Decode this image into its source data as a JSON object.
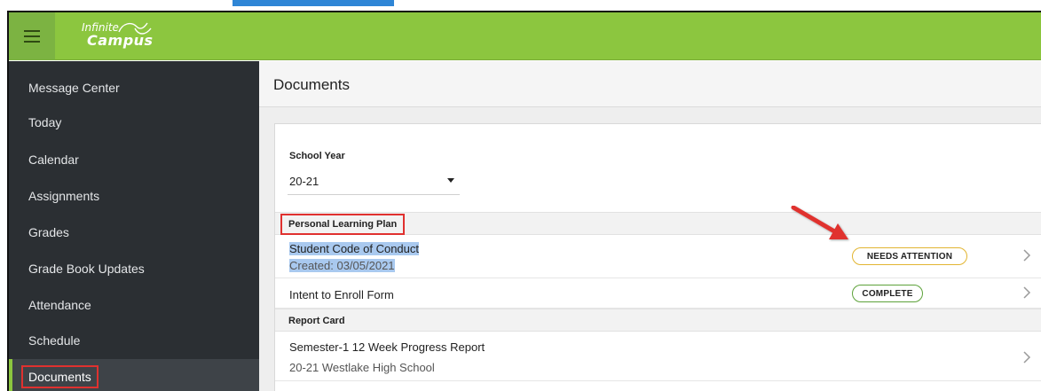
{
  "app": {
    "brand_line1": "Infinite",
    "brand_line2": "Campus"
  },
  "sidebar": {
    "items": [
      {
        "label": "Message Center"
      },
      {
        "label": "Today"
      },
      {
        "label": "Calendar"
      },
      {
        "label": "Assignments"
      },
      {
        "label": "Grades"
      },
      {
        "label": "Grade Book Updates"
      },
      {
        "label": "Attendance"
      },
      {
        "label": "Schedule"
      },
      {
        "label": "Documents",
        "active": true
      }
    ]
  },
  "main": {
    "title": "Documents",
    "school_year": {
      "label": "School Year",
      "value": "20-21"
    },
    "sections": [
      {
        "title": "Personal Learning Plan",
        "rows": [
          {
            "title": "Student Code of Conduct",
            "subtitle": "Created: 03/05/2021",
            "status": "NEEDS ATTENTION"
          },
          {
            "title": "Intent to Enroll Form",
            "status": "COMPLETE"
          }
        ]
      },
      {
        "title": "Report Card",
        "rows": [
          {
            "title": "Semester-1 12 Week Progress Report",
            "subtitle": "20-21 Westlake High School"
          }
        ]
      }
    ]
  },
  "colors": {
    "header_green": "#8cc63f",
    "sidebar_dark": "#2b2f33",
    "annotation_red": "#e0312f",
    "needs_attention": "#e2b531",
    "complete": "#5da23a",
    "text_selection": "#a9c9ef"
  },
  "icons": {
    "menu": "hamburger-menu-icon",
    "row_link": "chevron-right-icon",
    "dropdown": "caret-down-icon"
  }
}
